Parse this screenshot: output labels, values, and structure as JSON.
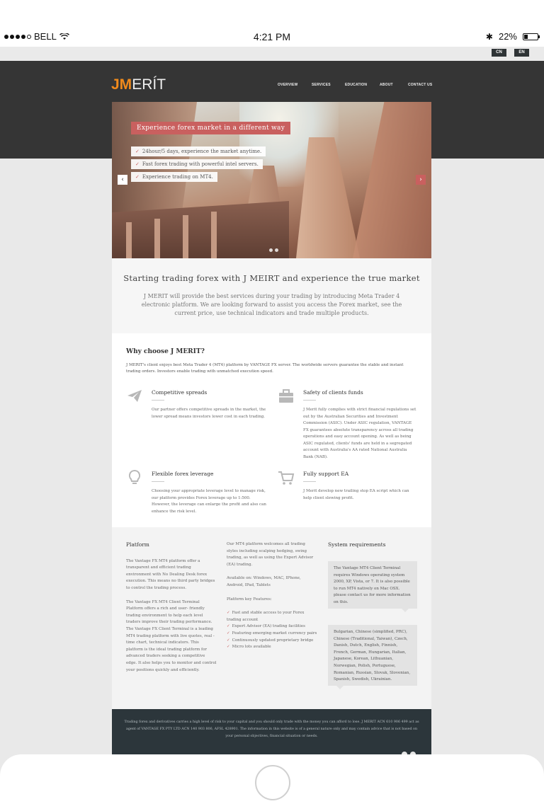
{
  "status": {
    "carrier": "BELL",
    "time": "4:21 PM",
    "battery": "22%"
  },
  "languages": [
    "CN",
    "EN"
  ],
  "brand": {
    "logo_jm": "JM",
    "logo_rest": "ERÍT"
  },
  "nav": [
    "OVERVIEW",
    "SERVICES",
    "EDUCATION",
    "ABOUT",
    "CONTACT US"
  ],
  "hero": {
    "title": "Experience forex market in a different way",
    "items": [
      "24hour/5 days, experience the market anytime.",
      "Fast forex trading with powerful intel servers.",
      "Experience trading on MT4."
    ],
    "prev": "‹",
    "next": "›"
  },
  "intro": {
    "heading": "Starting trading forex with J MEIRT and experience the true market",
    "text": "J MERIT will provide the best services during your trading by introducing Meta Trader 4 electronic platform. We are looking forward to assist you access the Forex market, see the current price, use technical indicators and trade multiple products."
  },
  "why": {
    "heading": "Why choose J MERIT?",
    "desc": "J MERIT's client enjoys best Meta Trader 4 (MT4) platform by VANTAGE FX server. The worldwide servers guarantee the stable and instant trading orders. Investors enable trading with unmatched execution speed.",
    "features": [
      {
        "icon": "paper-plane-icon",
        "title": "Competitive spreads",
        "text": "Our partner offers competitive spreads in the market, the lower spread means investors lower cost in each trading."
      },
      {
        "icon": "briefcase-icon",
        "title": "Safety of clients funds",
        "text": "J Merit fully complies with strict financial regulations set out by the Australian Securities and Investment Commission (ASIC). Under ASIC regulation, VANTAGE FX guarantees absolute transparency across all trading operations and easy account opening. As well as being ASIC regulated, clients' funds are held in a segregated account with Australia's AA rated National Australia Bank (NAB)."
      },
      {
        "icon": "lightbulb-icon",
        "title": "Flexible forex leverage",
        "text": "Choosing your appropriate leverage level to manage risk, our platform provides Forex leverage up to 1:500. However, the leverage can enlarge the profit and also can enhance the risk level."
      },
      {
        "icon": "cart-icon",
        "title": "Fully support EA",
        "text": "J Merit develop new trailing stop EA script which can help client slewing profit."
      }
    ]
  },
  "platform": {
    "heading": "Platform",
    "p1": "The Vantage FX MT4 platform offer a transparent and efficient trading environment with No Dealing Desk forex execution. This means no third party bridges to control the trading process.",
    "p2": "The Vantage FX MT4 Client Terminal Platform offers a rich and user- friendly trading environment to help each level traders improve their trading performance. The Vantage FX Client Terminal is a leading MT4 trading platform with live quotes, real - time chart, technical indicators. This platform is the ideal trading platform for advanced traders seeking a competitive edge. It also helps you to monitor and control your positions quickly and efficiently.",
    "mid_p1": "Our MT4 platform welcomes all trading styles including scalping hedging, swing trading, as well as using the Expert Advisor (EA) trading.",
    "mid_p2": "Available on: Windows, MAC, IPhone, Android, IPad, Tablets",
    "features_label": "Platform key Features:",
    "key_features": [
      "Fast and stable access to your Forex trading account",
      "Expert Advisor (EA) trading facilities",
      "Featuring emerging market currency pairs",
      "Continuously updated proprietary bridge",
      "Micro lots available"
    ],
    "sys_heading": "System requirements",
    "sys_text1": "The Vantage MT4 Client Terminal requires Windows operating system 2000, XP, Vista, or 7. It is also possible to run MT4 natively on Mac OSX. please contact us for more information on this.",
    "sys_text2": "Bulgarian, Chinese (simplified, PRC), Chinese (Traditional, Taiwan), Czech, Danish, Dutch, English, Finnish, French, German, Hungarian, Italian, Japanese, Korean, Lithuanian, Norwegian, Polish, Portuguese, Romanian, Russian, Slovak, Slovenian, Spanish, Swedish, Ukrainian."
  },
  "footer": {
    "text": "Trading forex and derivatives carries a high level of risk to your capital and you should only trade with the money you can afford to lose. J MERIT ACN 610 906 499 act as agent of VANTAGE FX PTY LTD ACN 140 903 806, AFSL 428901. The information in this website is of a general nature only and may contain advice that is not based on your personal objectives, financial situation or needs."
  },
  "colors": {
    "accent": "#c9605f",
    "logo_orange": "#f08a1c",
    "header_bg": "#353535",
    "footer_bg": "#2c363b"
  }
}
